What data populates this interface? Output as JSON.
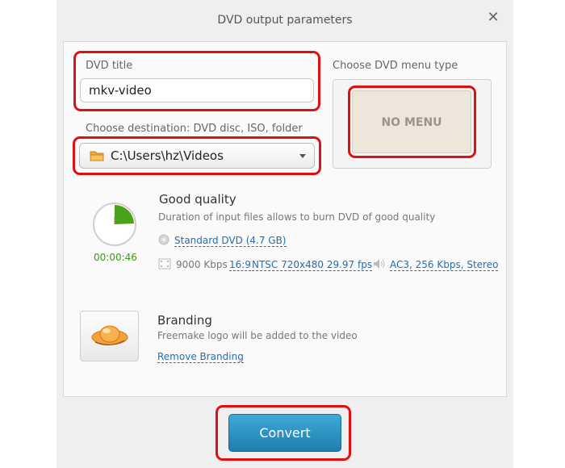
{
  "dialog": {
    "title": "DVD output parameters"
  },
  "dvd_title": {
    "label": "DVD title",
    "value": "mkv-video"
  },
  "destination": {
    "label": "Choose destination: DVD disc, ISO, folder",
    "value": "C:\\Users\\hz\\Videos"
  },
  "menu": {
    "label": "Choose DVD menu type",
    "option": "NO MENU"
  },
  "quality": {
    "title": "Good quality",
    "description": "Duration of input files allows to burn DVD of good quality",
    "duration": "00:00:46",
    "disc": "Standard DVD (4.7 GB)",
    "bitrate": "9000 Kbps",
    "aspect": "16:9",
    "video_format": "NTSC 720x480 29.97 fps",
    "audio": "AC3, 256 Kbps, Stereo"
  },
  "branding": {
    "title": "Branding",
    "description": "Freemake logo will be added to the video",
    "remove_link": "Remove Branding"
  },
  "actions": {
    "convert_label": "Convert"
  },
  "colors": {
    "highlight": "#e01010",
    "accent": "#1f6fb6",
    "convert": "#2a90c2",
    "duration_green": "#3a9a1a"
  }
}
